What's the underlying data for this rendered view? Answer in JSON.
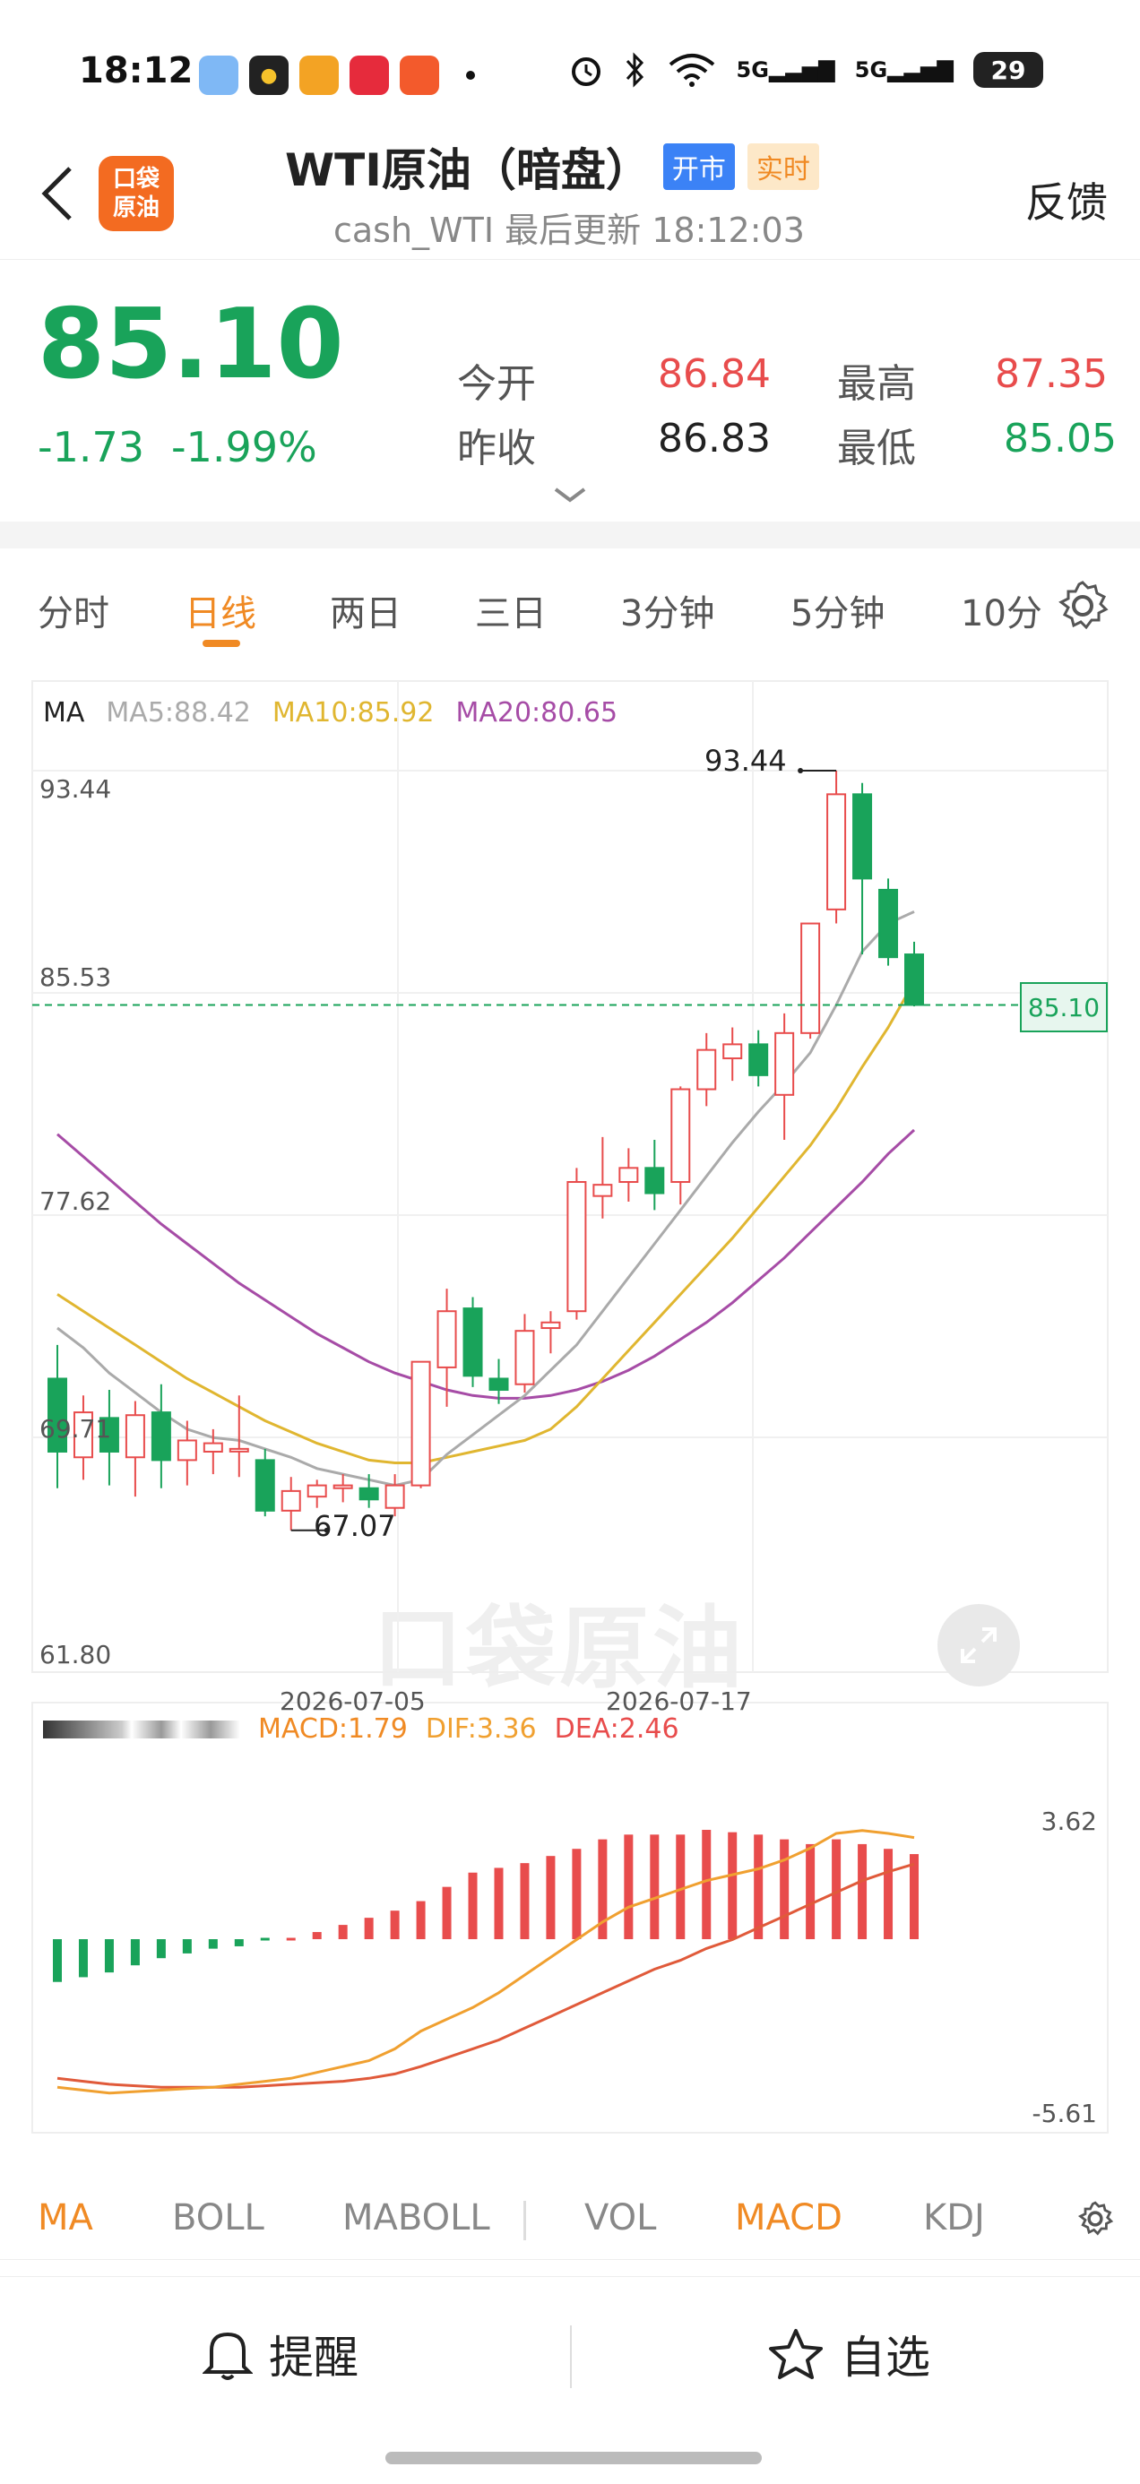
{
  "status_bar": {
    "time": "18:12",
    "battery": "29",
    "net_label_1": "5G",
    "net_label_2": "5G"
  },
  "header": {
    "logo_text_1": "口袋",
    "logo_text_2": "原油",
    "title": "WTI原油（暗盘）",
    "tag_open": "开市",
    "tag_live": "实时",
    "subtitle": "cash_WTI 最后更新 18:12:03",
    "feedback": "反馈"
  },
  "quote": {
    "price": "85.10",
    "change": "-1.73",
    "change_pct": "-1.99%",
    "open_label": "今开",
    "open_value": "86.84",
    "high_label": "最高",
    "high_value": "87.35",
    "prev_close_label": "昨收",
    "prev_close_value": "86.83",
    "low_label": "最低",
    "low_value": "85.05"
  },
  "tabs": [
    "分时",
    "日线",
    "两日",
    "三日",
    "3分钟",
    "5分钟",
    "10分"
  ],
  "active_tab": 1,
  "chart": {
    "ma_label": "MA",
    "ma5": "MA5:88.42",
    "ma10": "MA10:85.92",
    "ma20": "MA20:80.65",
    "y_labels": [
      "93.44",
      "85.53",
      "77.62",
      "69.71",
      "61.80"
    ],
    "x_labels": [
      "2026-07-05",
      "2026-07-17"
    ],
    "max_annotation": "93.44",
    "min_annotation": "67.07",
    "current_price_marker": "85.10",
    "watermark": "口袋原油",
    "colors": {
      "up": "#e84c4c",
      "down": "#19a35a",
      "ma5": "#aaaaaa",
      "ma10": "#e0b630",
      "ma20": "#a64ca6"
    }
  },
  "macd": {
    "macd": "MACD:1.79",
    "dif": "DIF:3.36",
    "dea": "DEA:2.46",
    "y_top": "3.62",
    "y_bottom": "-5.61"
  },
  "indicators": [
    "MA",
    "BOLL",
    "MABOLL",
    "VOL",
    "MACD",
    "KDJ"
  ],
  "bottom": {
    "alert": "提醒",
    "watchlist": "自选"
  },
  "chart_data": {
    "type": "candlestick",
    "ylim": [
      61.8,
      93.44
    ],
    "y_ticks": [
      93.44,
      85.53,
      77.62,
      69.71,
      61.8
    ],
    "x_tick_labels": [
      "2026-07-05",
      "2026-07-17"
    ],
    "ohlc": [
      [
        71.8,
        73.0,
        67.9,
        69.2
      ],
      [
        69.0,
        71.2,
        68.2,
        70.6
      ],
      [
        70.4,
        71.4,
        68.0,
        69.2
      ],
      [
        69.0,
        71.0,
        67.6,
        70.5
      ],
      [
        70.6,
        71.6,
        67.9,
        68.9
      ],
      [
        68.9,
        70.3,
        68.0,
        69.6
      ],
      [
        69.2,
        70.0,
        68.4,
        69.5
      ],
      [
        69.3,
        71.2,
        68.3,
        69.3
      ],
      [
        68.9,
        69.3,
        66.9,
        67.1
      ],
      [
        67.1,
        68.3,
        66.4,
        67.8
      ],
      [
        67.6,
        68.2,
        67.2,
        68.0
      ],
      [
        67.9,
        68.4,
        67.4,
        68.0
      ],
      [
        67.9,
        68.4,
        67.2,
        67.5
      ],
      [
        67.2,
        68.4,
        66.9,
        68.0
      ],
      [
        68.0,
        72.4,
        67.9,
        72.4
      ],
      [
        72.2,
        75.0,
        70.8,
        74.2
      ],
      [
        74.3,
        74.7,
        71.5,
        71.9
      ],
      [
        71.8,
        72.5,
        70.9,
        71.4
      ],
      [
        71.6,
        74.1,
        71.3,
        73.5
      ],
      [
        73.6,
        74.2,
        72.7,
        73.8
      ],
      [
        74.2,
        79.3,
        73.9,
        78.8
      ],
      [
        78.3,
        80.4,
        77.5,
        78.7
      ],
      [
        78.8,
        80.0,
        78.1,
        79.3
      ],
      [
        79.3,
        80.3,
        77.8,
        78.4
      ],
      [
        78.8,
        82.2,
        78.0,
        82.1
      ],
      [
        82.1,
        84.1,
        81.5,
        83.5
      ],
      [
        83.2,
        84.3,
        82.4,
        83.7
      ],
      [
        83.7,
        84.2,
        82.2,
        82.6
      ],
      [
        81.9,
        84.8,
        80.3,
        84.1
      ],
      [
        84.1,
        88.0,
        83.9,
        88.0
      ],
      [
        88.5,
        93.44,
        88.0,
        92.6
      ],
      [
        92.6,
        93.0,
        86.9,
        89.6
      ],
      [
        89.2,
        89.6,
        86.5,
        86.8
      ],
      [
        86.9,
        87.35,
        85.05,
        85.1
      ]
    ],
    "ma5": [
      73.6,
      72.9,
      72.0,
      71.3,
      70.6,
      70.0,
      69.7,
      69.6,
      69.3,
      69.0,
      68.6,
      68.4,
      68.2,
      68.0,
      68.2,
      69.1,
      69.8,
      70.5,
      71.2,
      72.1,
      73.0,
      74.2,
      75.4,
      76.6,
      77.8,
      79.0,
      80.2,
      81.3,
      82.3,
      83.4,
      85.1,
      87.0,
      88.0,
      88.42
    ],
    "ma10": [
      74.8,
      74.2,
      73.6,
      73.0,
      72.4,
      71.8,
      71.3,
      70.8,
      70.3,
      69.9,
      69.5,
      69.2,
      68.9,
      68.8,
      68.8,
      69.0,
      69.2,
      69.4,
      69.6,
      70.0,
      70.8,
      71.8,
      72.8,
      73.8,
      74.8,
      75.8,
      76.8,
      77.9,
      79.0,
      80.1,
      81.4,
      82.9,
      84.3,
      85.92
    ],
    "ma20": [
      80.5,
      79.7,
      78.9,
      78.1,
      77.3,
      76.6,
      75.9,
      75.2,
      74.6,
      74.0,
      73.4,
      72.9,
      72.4,
      72.0,
      71.7,
      71.4,
      71.2,
      71.1,
      71.1,
      71.2,
      71.4,
      71.7,
      72.1,
      72.6,
      73.2,
      73.8,
      74.5,
      75.3,
      76.1,
      77.0,
      77.9,
      78.8,
      79.8,
      80.65
    ],
    "macd_hist": [
      -0.9,
      -0.8,
      -0.7,
      -0.55,
      -0.4,
      -0.3,
      -0.2,
      -0.15,
      -0.1,
      0.05,
      0.15,
      0.3,
      0.45,
      0.6,
      0.8,
      1.1,
      1.4,
      1.5,
      1.6,
      1.75,
      1.9,
      2.1,
      2.2,
      2.2,
      2.2,
      2.3,
      2.25,
      2.2,
      2.1,
      2.0,
      2.1,
      2.0,
      1.9,
      1.79
    ],
    "dif": [
      -5.1,
      -5.2,
      -5.3,
      -5.25,
      -5.2,
      -5.15,
      -5.1,
      -5.0,
      -4.9,
      -4.8,
      -4.6,
      -4.4,
      -4.2,
      -3.8,
      -3.2,
      -2.8,
      -2.4,
      -1.9,
      -1.3,
      -0.7,
      -0.1,
      0.5,
      1.0,
      1.3,
      1.6,
      1.9,
      2.1,
      2.3,
      2.6,
      3.0,
      3.5,
      3.6,
      3.5,
      3.36
    ],
    "dea": [
      -4.8,
      -4.9,
      -5.0,
      -5.05,
      -5.1,
      -5.1,
      -5.1,
      -5.1,
      -5.05,
      -5.0,
      -4.95,
      -4.9,
      -4.8,
      -4.65,
      -4.4,
      -4.1,
      -3.8,
      -3.5,
      -3.1,
      -2.7,
      -2.3,
      -1.9,
      -1.5,
      -1.1,
      -0.8,
      -0.4,
      -0.1,
      0.3,
      0.7,
      1.1,
      1.5,
      1.9,
      2.2,
      2.46
    ],
    "macd_ylim": [
      -5.61,
      3.62
    ]
  }
}
